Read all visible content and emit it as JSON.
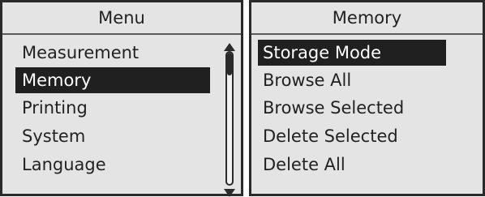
{
  "menu_panel": {
    "title": "Menu",
    "items": [
      {
        "label": "Measurement",
        "selected": false
      },
      {
        "label": "Memory",
        "selected": true
      },
      {
        "label": "Printing",
        "selected": false
      },
      {
        "label": "System",
        "selected": false
      },
      {
        "label": "Language",
        "selected": false
      }
    ],
    "scroll_position": 0.0
  },
  "memory_panel": {
    "title": "Memory",
    "items": [
      {
        "label": "Storage Mode",
        "selected": true
      },
      {
        "label": "Browse All",
        "selected": false
      },
      {
        "label": "Browse Selected",
        "selected": false
      },
      {
        "label": "Delete Selected",
        "selected": false
      },
      {
        "label": "Delete All",
        "selected": false
      }
    ]
  },
  "colors": {
    "background": "#e4e4e4",
    "border": "#2a2a2a",
    "selection_bg": "#202020",
    "selection_text": "#ffffff"
  }
}
